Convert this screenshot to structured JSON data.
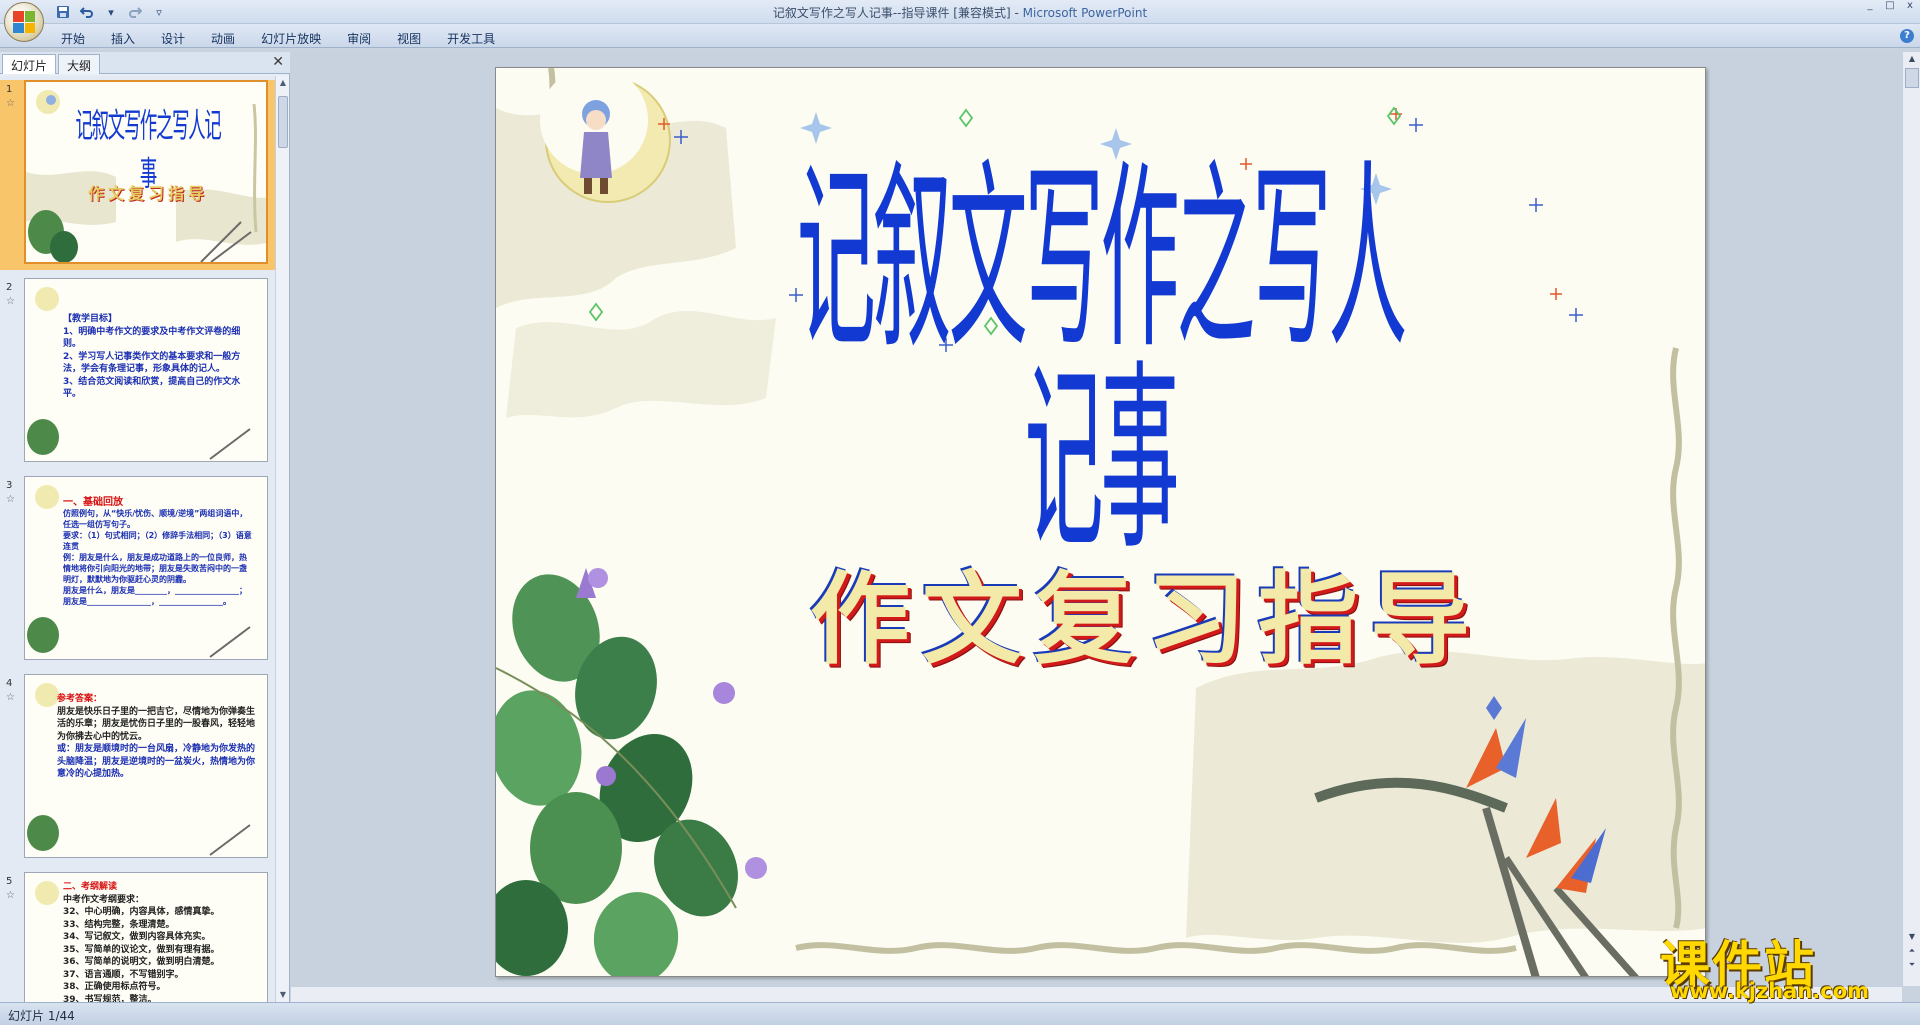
{
  "window": {
    "title": "记叙文写作之写人记事--指导课件 [兼容模式]",
    "app_name": "Microsoft PowerPoint",
    "controls": [
      "_",
      "□",
      "x"
    ]
  },
  "qat": {
    "save_icon": "save-icon",
    "undo_icon": "undo-icon",
    "redo_icon": "redo-icon"
  },
  "ribbon": {
    "tabs": [
      "开始",
      "插入",
      "设计",
      "动画",
      "幻灯片放映",
      "审阅",
      "视图",
      "开发工具"
    ],
    "help": "?"
  },
  "left_pane": {
    "tabs": [
      "幻灯片",
      "大纲"
    ],
    "close": "✕",
    "slides": [
      {
        "num": "1",
        "star": "☆",
        "title": "记叙文写作之写人记事",
        "subtitle": "作文复习指导"
      },
      {
        "num": "2",
        "star": "☆",
        "lines": [
          "【教学目标】",
          "1、明确中考作文的要求及中考作文评卷的细则。",
          "2、学习写人记事类作文的基本要求和一般方法，学会有条理记事，形象具体的记人。",
          "3、结合范文阅读和欣赏，提高自己的作文水平。"
        ]
      },
      {
        "num": "3",
        "star": "☆",
        "heading": "一、基础回放",
        "lines": [
          "仿照例句，从“快乐/忧伤、顺境/逆境”两组词语中，任选一组仿写句子。",
          "要求：（1）句式相同；（2）修辞手法相同；（3）语意连贯",
          "例：朋友是什么，朋友是成功道路上的一位良师，热情地将你引向阳光的地带；朋友是失败苦闷中的一盏明灯，默默地为你驱赶心灵的阴霾。",
          "朋友是什么，朋友是________，________________；",
          "朋友是________________，________________。"
        ]
      },
      {
        "num": "4",
        "star": "☆",
        "heading": "参考答案：",
        "lines": [
          "朋友是快乐日子里的一把吉它，尽情地为你弹奏生活的乐章；朋友是忧伤日子里的一股春风，轻轻地为你拂去心中的忧云。",
          "或：朋友是顺境时的一台风扇，冷静地为你发热的头脑降温；朋友是逆境时的一盆炭火，热情地为你意冷的心提加热。"
        ]
      },
      {
        "num": "5",
        "star": "☆",
        "heading": "二、考纲解读",
        "lines": [
          "中考作文考纲要求：",
          "32、中心明确，内容具体，感情真挚。",
          "33、结构完整，条理清楚。",
          "34、写记叙文，做到内容具体充实。",
          "35、写简单的议论文，做到有理有据。",
          "36、写简单的说明文，做到明白清楚。",
          "37、语言通顺，不写错别字。",
          "38、正确使用标点符号。",
          "39、书写规范，整洁。"
        ]
      }
    ]
  },
  "slide": {
    "title": "记叙文写作之写人记事",
    "subtitle": "作文复习指导"
  },
  "status": {
    "slide_counter": "幻灯片 1/44"
  },
  "watermark": {
    "cn": "课件站",
    "url": "www.kjzhan.com"
  },
  "colors": {
    "title_blue": "#1239d2",
    "subtitle_fill": "#f3e9a8",
    "subtitle_red": "#d21a1a",
    "watermark_yellow": "#ffd800",
    "thumb_selected": "#f9c56b"
  }
}
